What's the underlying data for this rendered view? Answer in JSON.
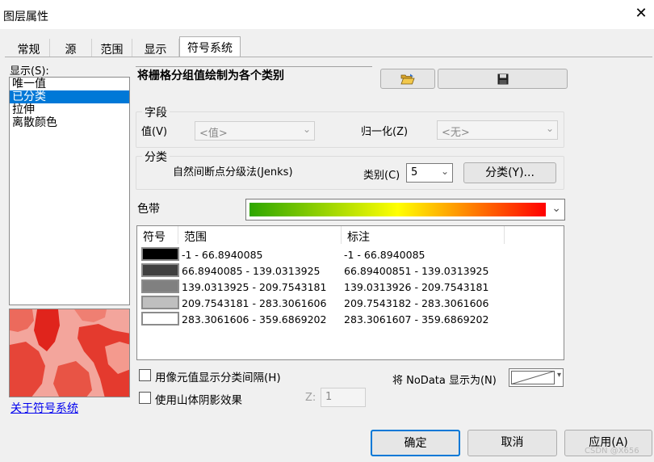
{
  "window": {
    "title": "图层属性",
    "close_glyph": "✕"
  },
  "tabs": [
    {
      "label": "常规"
    },
    {
      "label": "源"
    },
    {
      "label": "范围"
    },
    {
      "label": "显示"
    },
    {
      "label": "符号系统"
    }
  ],
  "show_section": {
    "label": "显示(S):",
    "items": [
      {
        "label": "唯一值"
      },
      {
        "label": "已分类"
      },
      {
        "label": "拉伸"
      },
      {
        "label": "离散颜色"
      }
    ],
    "selected_index": 1,
    "about_link": "关于符号系统"
  },
  "description": "将栅格分组值绘制为各个类别",
  "toolbar": {
    "open_icon": "folder-open-icon",
    "save_icon": "floppy-save-icon"
  },
  "field_group": {
    "legend": "字段",
    "value_label": "值(V)",
    "value_selected": "<值>",
    "normalize_label": "归一化(Z)",
    "normalize_selected": "<无>"
  },
  "class_group": {
    "legend": "分类",
    "method": "自然间断点分级法(Jenks)",
    "classes_label": "类别(C)",
    "classes_value": "5",
    "classify_button": "分类(Y)..."
  },
  "color_ramp": {
    "label": "色带",
    "colors": [
      "#2ea600",
      "#ffff00",
      "#ff0000"
    ]
  },
  "table": {
    "headers": {
      "symbol": "符号",
      "range": "范围",
      "label": "标注"
    },
    "rows": [
      {
        "color": "#000000",
        "range": "-1 - 66.8940085",
        "label": "-1 - 66.8940085"
      },
      {
        "color": "#404040",
        "range": "66.8940085 - 139.0313925",
        "label": "66.89400851 - 139.0313925"
      },
      {
        "color": "#808080",
        "range": "139.0313925 - 209.7543181",
        "label": "139.0313926 - 209.7543181"
      },
      {
        "color": "#bfbfbf",
        "range": "209.7543181 - 283.3061606",
        "label": "209.7543182 - 283.3061606"
      },
      {
        "color": "#ffffff",
        "range": "283.3061606 - 359.6869202",
        "label": "283.3061607 - 359.6869202"
      }
    ]
  },
  "options": {
    "pixel_interval_label": "用像元值显示分类间隔(H)",
    "hillshade_label": "使用山体阴影效果",
    "z_label": "Z:",
    "z_value": "1",
    "nodata_label": "将 NoData 显示为(N)"
  },
  "footer": {
    "ok": "确定",
    "cancel": "取消",
    "apply": "应用(A)",
    "watermark": "CSDN @X656"
  }
}
